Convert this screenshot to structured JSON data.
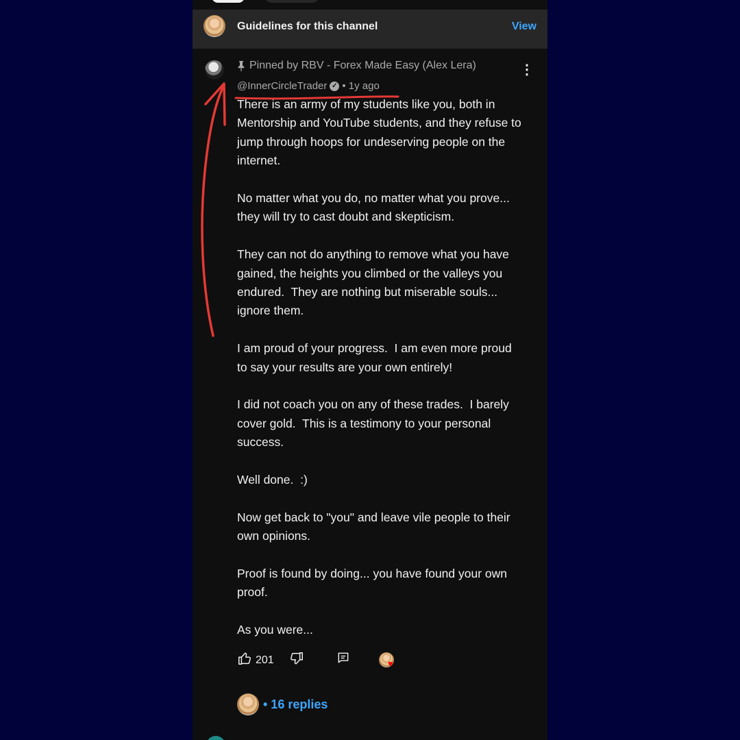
{
  "guidelines": {
    "title": "Guidelines for this channel",
    "view_label": "View"
  },
  "comment": {
    "pinned_label": "Pinned by RBV - Forex Made Easy (Alex Lera)",
    "author": "@InnerCircleTrader",
    "time": "• 1y ago",
    "paragraphs": [
      "There is an army of my students like you, both in Mentorship and YouTube students, and they refuse to jump through hoops for undeserving people on the internet.",
      "No matter what you do, no matter what you prove... they will try to cast doubt and skepticism.",
      "They can not do anything to remove what you have gained, the heights you climbed or the valleys you endured.  They are nothing but miserable souls... ignore them.",
      "I am proud of your progress.  I am even more proud to say your results are your own entirely!",
      "I did not coach you on any of these trades.  I barely cover gold.  This is a testimony to your personal success.",
      "Well done.  :)",
      "Now get back to \"you\" and leave vile people to their own opinions.",
      "Proof is found by doing... you have found your own proof.",
      "As you were..."
    ],
    "like_count": "201",
    "replies_label": "• 16 replies"
  },
  "icons": {
    "pin": "pin-icon",
    "verified": "verified-check-icon",
    "more": "more-vert-icon",
    "like": "thumbs-up-icon",
    "dislike": "thumbs-down-icon",
    "reply": "comment-icon",
    "heart": "heart-icon"
  },
  "colors": {
    "background": "#01023a",
    "app_background": "#0f0f0f",
    "banner_background": "#272727",
    "link": "#3ea6ff",
    "annotation": "#e53935",
    "heart": "#ff0000"
  }
}
